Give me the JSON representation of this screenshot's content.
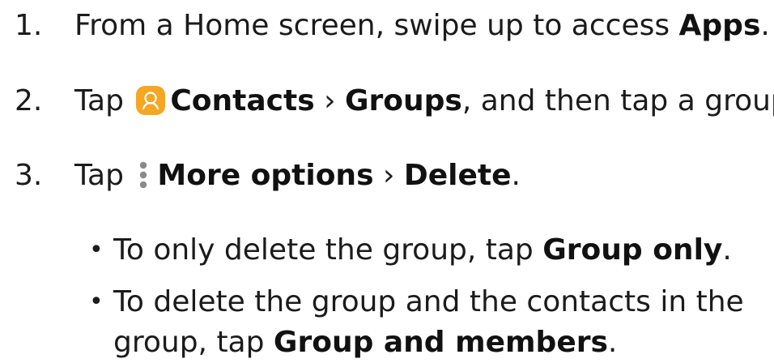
{
  "steps": [
    {
      "number": "1.",
      "text_before": "From a Home screen, swipe up to access ",
      "bold": "Apps",
      "text_after": "."
    },
    {
      "number": "2.",
      "text_tap": "Tap",
      "icon": "contacts-app-icon",
      "bold_1": "Contacts",
      "separator": "›",
      "bold_2": "Groups",
      "text_after": ", and then tap a group."
    },
    {
      "number": "3.",
      "text_tap": "Tap",
      "icon": "more-options-icon",
      "bold_1": "More options",
      "separator": "›",
      "bold_2": "Delete",
      "text_after": "."
    }
  ],
  "bullets": [
    {
      "text_before": "To only delete the group, tap ",
      "bold": "Group only",
      "text_after": "."
    },
    {
      "line_1": "To delete the group and the contacts in the",
      "line_2_before": "group, tap ",
      "bold": "Group and members",
      "text_after": "."
    }
  ],
  "colors": {
    "text": "#1b1b1b",
    "contacts_icon_bg": "#f5a623",
    "more_icon_dots": "#8a8a8a"
  }
}
